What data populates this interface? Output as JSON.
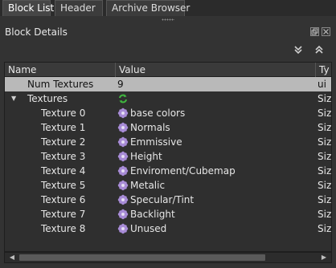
{
  "tabs": [
    {
      "label": "Block List",
      "active": true
    },
    {
      "label": "Header",
      "active": false
    },
    {
      "label": "Archive Browser",
      "active": false
    }
  ],
  "panel": {
    "title": "Block Details",
    "float_icon": "float-icon",
    "close_icon": "close-icon"
  },
  "toolbar": {
    "collapse_icon": "chevron-double-down-icon",
    "expand_icon": "chevron-double-up-icon"
  },
  "columns": {
    "name": "Name",
    "value": "Value",
    "type": "Ty"
  },
  "rows": [
    {
      "name": "Num Textures",
      "value": "9",
      "type": "ui"
    },
    {
      "name": "Textures",
      "value": "",
      "type": "Siz"
    },
    {
      "name": "Texture 0",
      "value": "base colors",
      "type": "Siz"
    },
    {
      "name": "Texture 1",
      "value": "Normals",
      "type": "Siz"
    },
    {
      "name": "Texture 2",
      "value": "Emmissive",
      "type": "Siz"
    },
    {
      "name": "Texture 3",
      "value": "Height",
      "type": "Siz"
    },
    {
      "name": "Texture 4",
      "value": "Enviroment/Cubemap",
      "type": "Siz"
    },
    {
      "name": "Texture 5",
      "value": "Metalic",
      "type": "Siz"
    },
    {
      "name": "Texture 6",
      "value": "Specular/Tint",
      "type": "Siz"
    },
    {
      "name": "Texture 7",
      "value": "Backlight",
      "type": "Siz"
    },
    {
      "name": "Texture 8",
      "value": "Unused",
      "type": "Siz"
    }
  ],
  "colors": {
    "background": "#333333",
    "selected_row": "#b9b9b9",
    "texture_icon": "#a78bd6",
    "refresh_icon": "#3fb53f"
  }
}
